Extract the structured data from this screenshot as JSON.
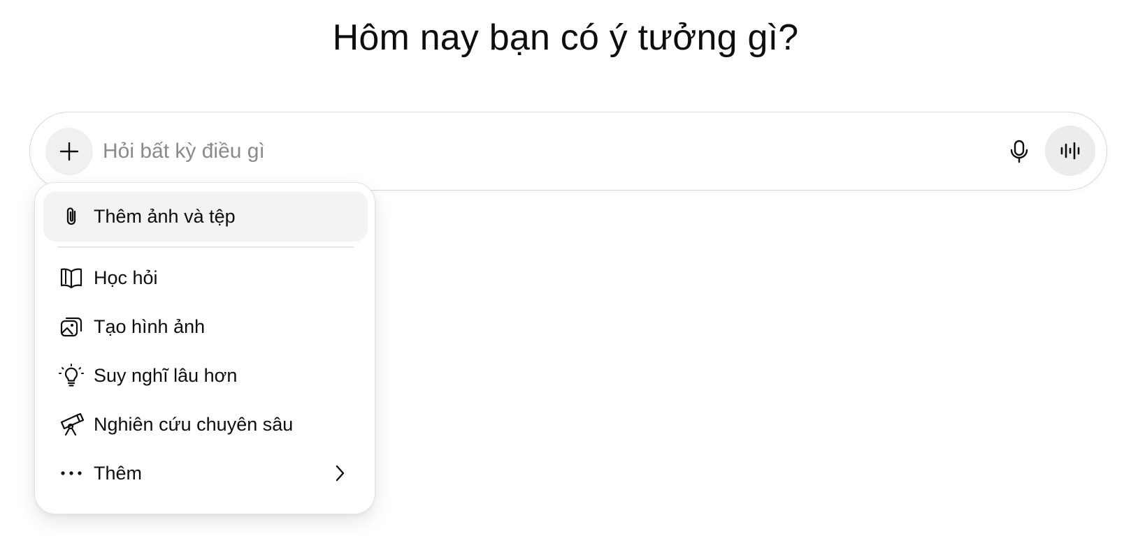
{
  "headline": "Hôm nay bạn có ý tưởng gì?",
  "composer": {
    "placeholder": "Hỏi bất kỳ điều gì",
    "value": "",
    "icons": {
      "add": "plus-icon",
      "mic": "microphone-icon",
      "voice": "voice-waveform-icon"
    }
  },
  "menu": {
    "items": [
      {
        "label": "Thêm ảnh và tệp",
        "icon": "paperclip-icon",
        "highlighted": true
      },
      {
        "label": "Học hỏi",
        "icon": "open-book-icon"
      },
      {
        "label": "Tạo hình ảnh",
        "icon": "image-stack-icon"
      },
      {
        "label": "Suy nghĩ lâu hơn",
        "icon": "lightbulb-icon"
      },
      {
        "label": "Nghiên cứu chuyên sâu",
        "icon": "telescope-icon"
      },
      {
        "label": "Thêm",
        "icon": "more-dots-icon",
        "submenu_icon": "chevron-right-icon"
      }
    ]
  },
  "colors": {
    "text": "#0d0d0d",
    "placeholder": "#8a8a8a",
    "button_bg": "#f0f0f0",
    "active_item_bg": "#f3f3f3",
    "border": "#d9d9d9"
  }
}
